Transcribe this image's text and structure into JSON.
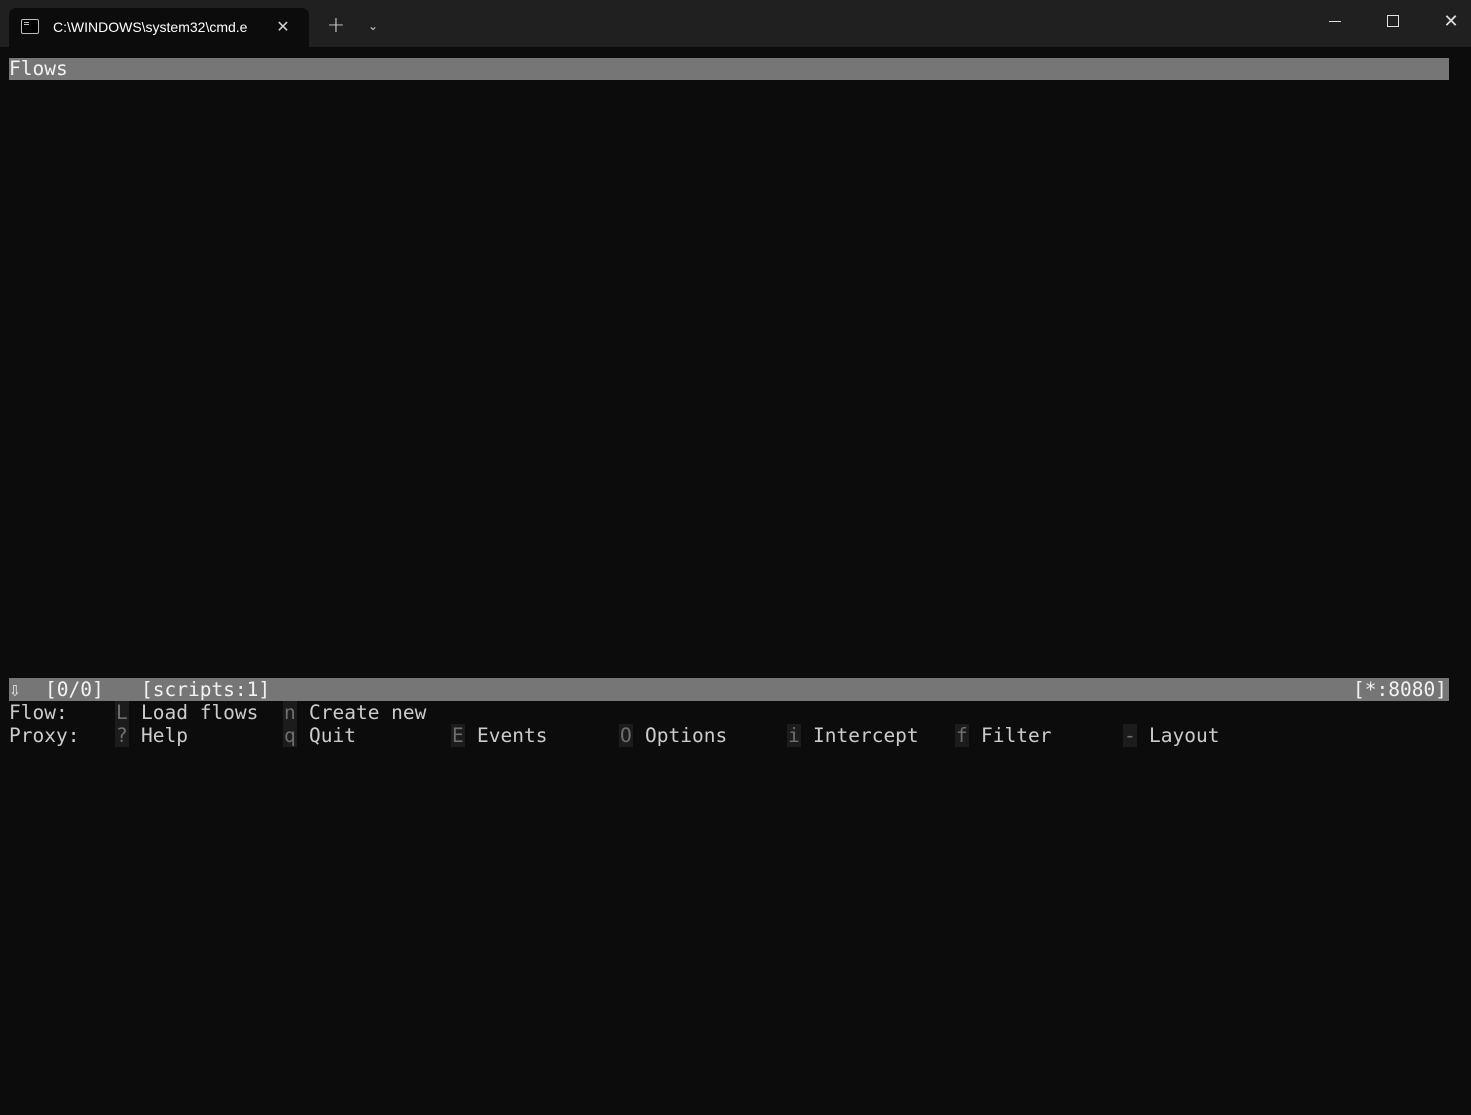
{
  "window": {
    "tab_title": "C:\\WINDOWS\\system32\\cmd.e",
    "new_tab_glyph": "+",
    "dropdown_glyph": "⌄",
    "close_glyph": "✕",
    "icons": [
      "cmd-icon",
      "close-icon",
      "plus-icon",
      "chevron-down-icon",
      "minimize-icon",
      "maximize-icon",
      "close-window-icon"
    ]
  },
  "terminal": {
    "header_title": "Flows",
    "status": {
      "arrow": "⇩",
      "count": "[0/0]",
      "scripts": "[scripts:1]",
      "listen": "[*:8080]"
    },
    "flow_row": {
      "label": "Flow:",
      "items": [
        {
          "key": "L",
          "label": "Load flows"
        },
        {
          "key": "n",
          "label": "Create new"
        }
      ]
    },
    "proxy_row": {
      "label": "Proxy:",
      "items": [
        {
          "key": "?",
          "label": "Help"
        },
        {
          "key": "q",
          "label": "Quit"
        },
        {
          "key": "E",
          "label": "Events"
        },
        {
          "key": "O",
          "label": "Options"
        },
        {
          "key": "i",
          "label": "Intercept"
        },
        {
          "key": "f",
          "label": "Filter"
        },
        {
          "key": "-",
          "label": "Layout"
        }
      ]
    }
  },
  "colors": {
    "terminal_bg": "#0c0c0c",
    "titlebar_bg": "#202020",
    "bar_bg": "#767676",
    "text": "#cccccc"
  }
}
